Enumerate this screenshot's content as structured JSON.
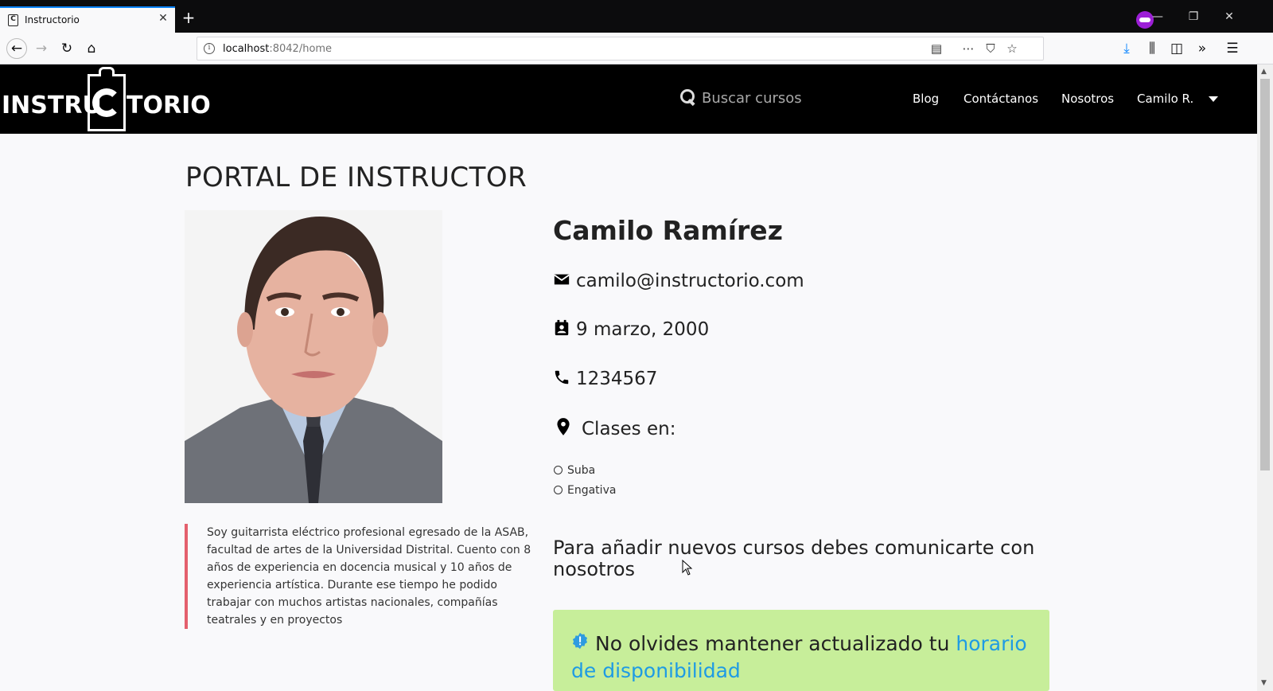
{
  "browser": {
    "tab_title": "Instructorio",
    "tab_favicon_glyph": "C",
    "url_host": "localhost",
    "url_rest": ":8042/home",
    "url_info_glyph": "i"
  },
  "site": {
    "logo": {
      "left_text": "INSTRU",
      "right_text": "TORIO"
    },
    "search_placeholder": "Buscar cursos",
    "nav": {
      "blog": "Blog",
      "contact": "Contáctanos",
      "about": "Nosotros",
      "user": "Camilo R."
    }
  },
  "profile": {
    "page_title": "PORTAL DE INSTRUCTOR",
    "name": "Camilo Ramírez",
    "email": "camilo@instructorio.com",
    "birthdate": "9 marzo, 2000",
    "phone": "1234567",
    "classes_label": "Clases en:",
    "locations": [
      "Suba",
      "Engativa"
    ],
    "bio": "Soy guitarrista eléctrico profesional egresado de la ASAB, facultad de artes de la Universidad Distrital. Cuento con 8 años de experiencia en docencia musical y 10 años de experiencia artística. Durante ese tiempo he podido trabajar con muchos artistas nacionales, compañías teatrales y en proyectos",
    "notice": "Para añadir nuevos cursos debes comunicarte con nosotros",
    "alert": {
      "text": "No olvides mantener actualizado tu ",
      "link": "horario de disponibilidad"
    }
  },
  "colors": {
    "header_bg": "#000000",
    "bio_border": "#e4606d",
    "alert_bg": "#c7ee9a",
    "link": "#1e9be4",
    "tab_accent": "#0a84ff"
  }
}
